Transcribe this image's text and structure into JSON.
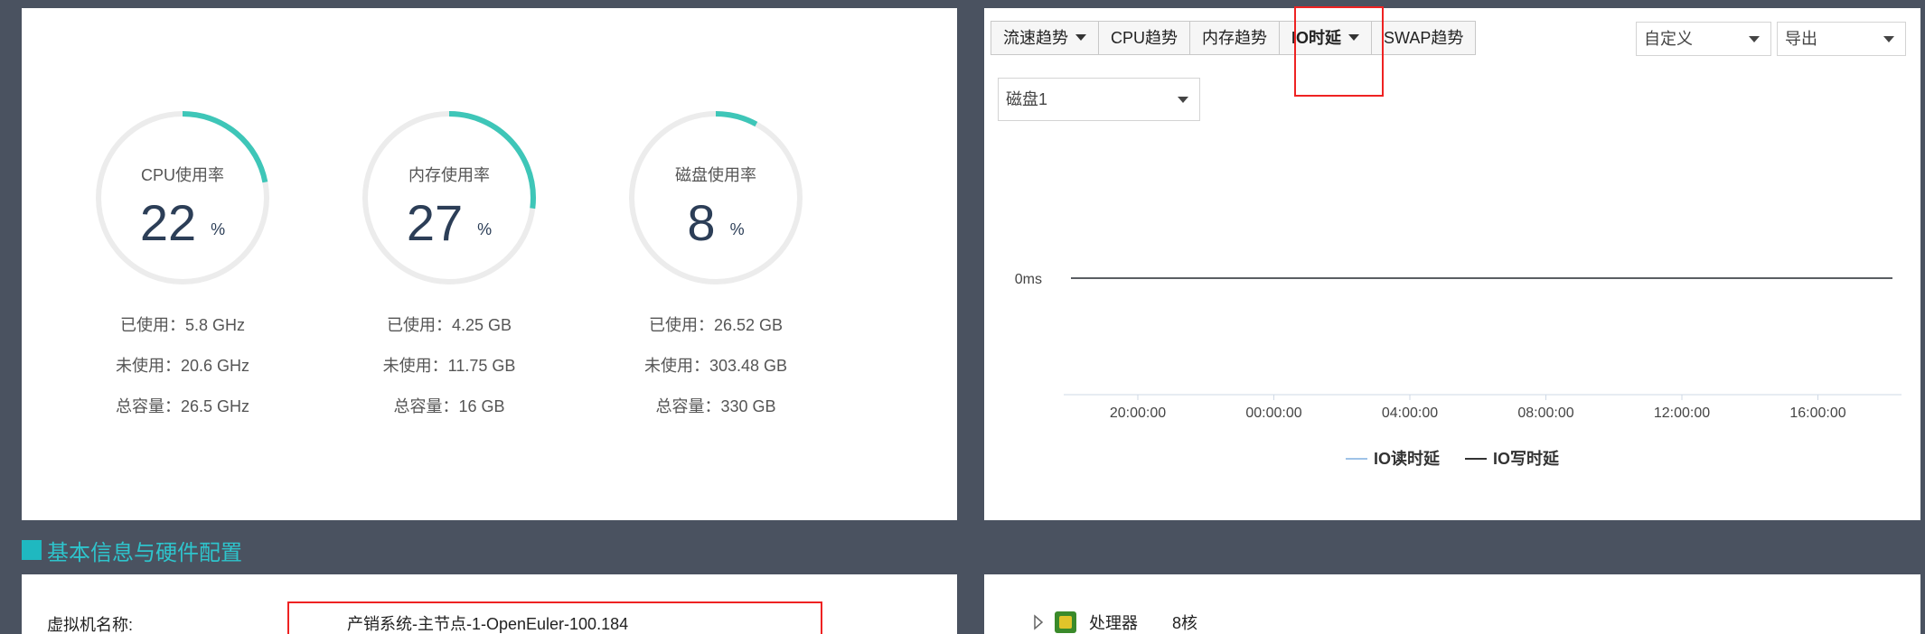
{
  "gauges": [
    {
      "title": "CPU使用率",
      "value": "22",
      "unit": "%",
      "percent": 22,
      "used": "已使用：5.8 GHz",
      "free": "未使用：20.6 GHz",
      "total": "总容量：26.5 GHz"
    },
    {
      "title": "内存使用率",
      "value": "27",
      "unit": "%",
      "percent": 27,
      "used": "已使用：4.25 GB",
      "free": "未使用：11.75 GB",
      "total": "总容量：16 GB"
    },
    {
      "title": "磁盘使用率",
      "value": "8",
      "unit": "%",
      "percent": 8,
      "used": "已使用：26.52 GB",
      "free": "未使用：303.48 GB",
      "total": "总容量：330 GB"
    }
  ],
  "trend_tabs": {
    "flow": "流速趋势",
    "cpu": "CPU趋势",
    "memory": "内存趋势",
    "io": "IO时延",
    "swap": "SWAP趋势"
  },
  "range_select": "自定义",
  "export_select": "导出",
  "disk_select": "磁盘1",
  "chart_data": {
    "type": "line",
    "x": [
      "20:00:00",
      "00:00:00",
      "04:00:00",
      "08:00:00",
      "12:00:00",
      "16:00:00"
    ],
    "y_ticks": [
      "0ms"
    ],
    "series": [
      {
        "name": "IO读时延",
        "values": [
          0,
          0,
          0,
          0,
          0,
          0
        ],
        "color": "#9fc3e7"
      },
      {
        "name": "IO写时延",
        "values": [
          0,
          0,
          0,
          0,
          0,
          0
        ],
        "color": "#333333"
      }
    ],
    "grid": false,
    "legend": "bottom"
  },
  "section": {
    "title": "基本信息与硬件配置"
  },
  "basic_info": {
    "vm_name_label": "虚拟机名称:",
    "vm_name_value": "产销系统-主节点-1-OpenEuler-100.184"
  },
  "hardware": {
    "processor_label": "处理器",
    "processor_value": "8核"
  },
  "colors": {
    "accent": "#3ec6b8",
    "track": "#ececec",
    "highlight": "#e22222",
    "section": "#2ec4cc"
  }
}
